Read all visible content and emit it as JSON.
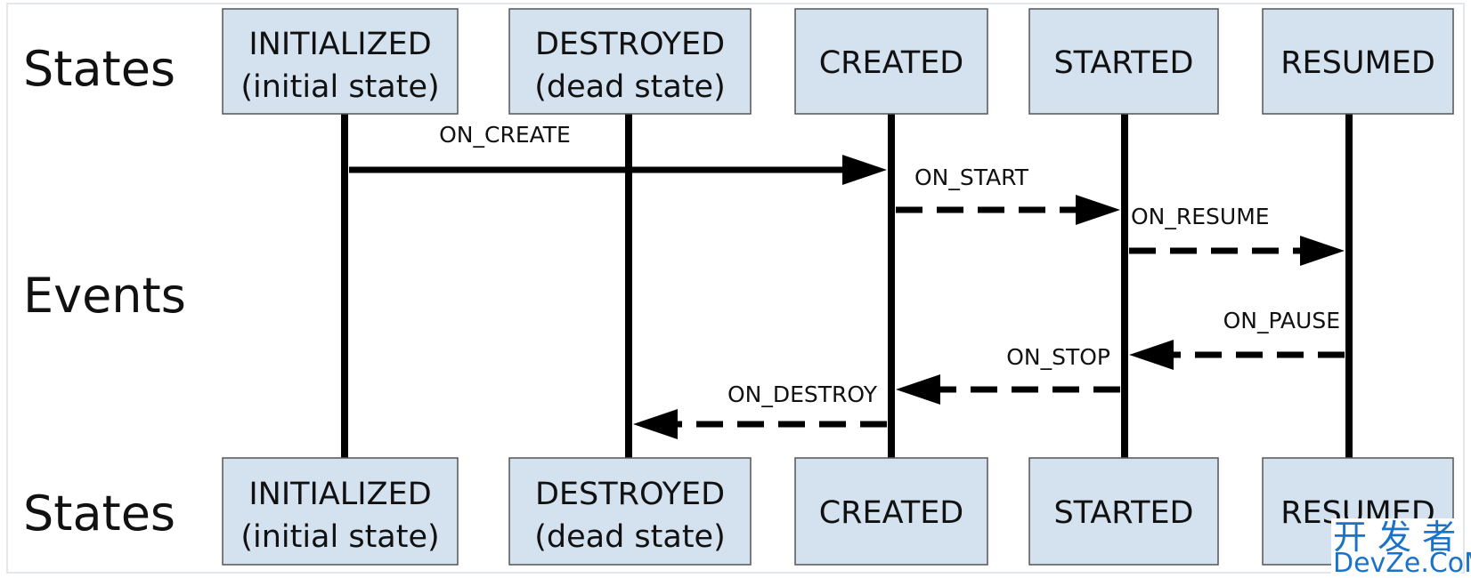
{
  "row_labels": {
    "top": "States",
    "middle": "Events",
    "bottom": "States"
  },
  "states": [
    {
      "line1": "INITIALIZED",
      "line2": "(initial state)"
    },
    {
      "line1": "DESTROYED",
      "line2": "(dead state)"
    },
    {
      "line1": "CREATED",
      "line2": ""
    },
    {
      "line1": "STARTED",
      "line2": ""
    },
    {
      "line1": "RESUMED",
      "line2": ""
    }
  ],
  "events": [
    {
      "label": "ON_CREATE",
      "from": "INITIALIZED",
      "to": "CREATED",
      "style": "solid"
    },
    {
      "label": "ON_START",
      "from": "CREATED",
      "to": "STARTED",
      "style": "dashed"
    },
    {
      "label": "ON_RESUME",
      "from": "STARTED",
      "to": "RESUMED",
      "style": "dashed"
    },
    {
      "label": "ON_PAUSE",
      "from": "RESUMED",
      "to": "STARTED",
      "style": "dashed"
    },
    {
      "label": "ON_STOP",
      "from": "STARTED",
      "to": "CREATED",
      "style": "dashed"
    },
    {
      "label": "ON_DESTROY",
      "from": "CREATED",
      "to": "DESTROYED",
      "style": "dashed"
    }
  ],
  "colors": {
    "state_box": "#d4e2f0",
    "line": "#000000",
    "watermark": "#1a73c8"
  },
  "watermark": {
    "line1": "开 发 者",
    "line2": "DevZe.CoM"
  }
}
